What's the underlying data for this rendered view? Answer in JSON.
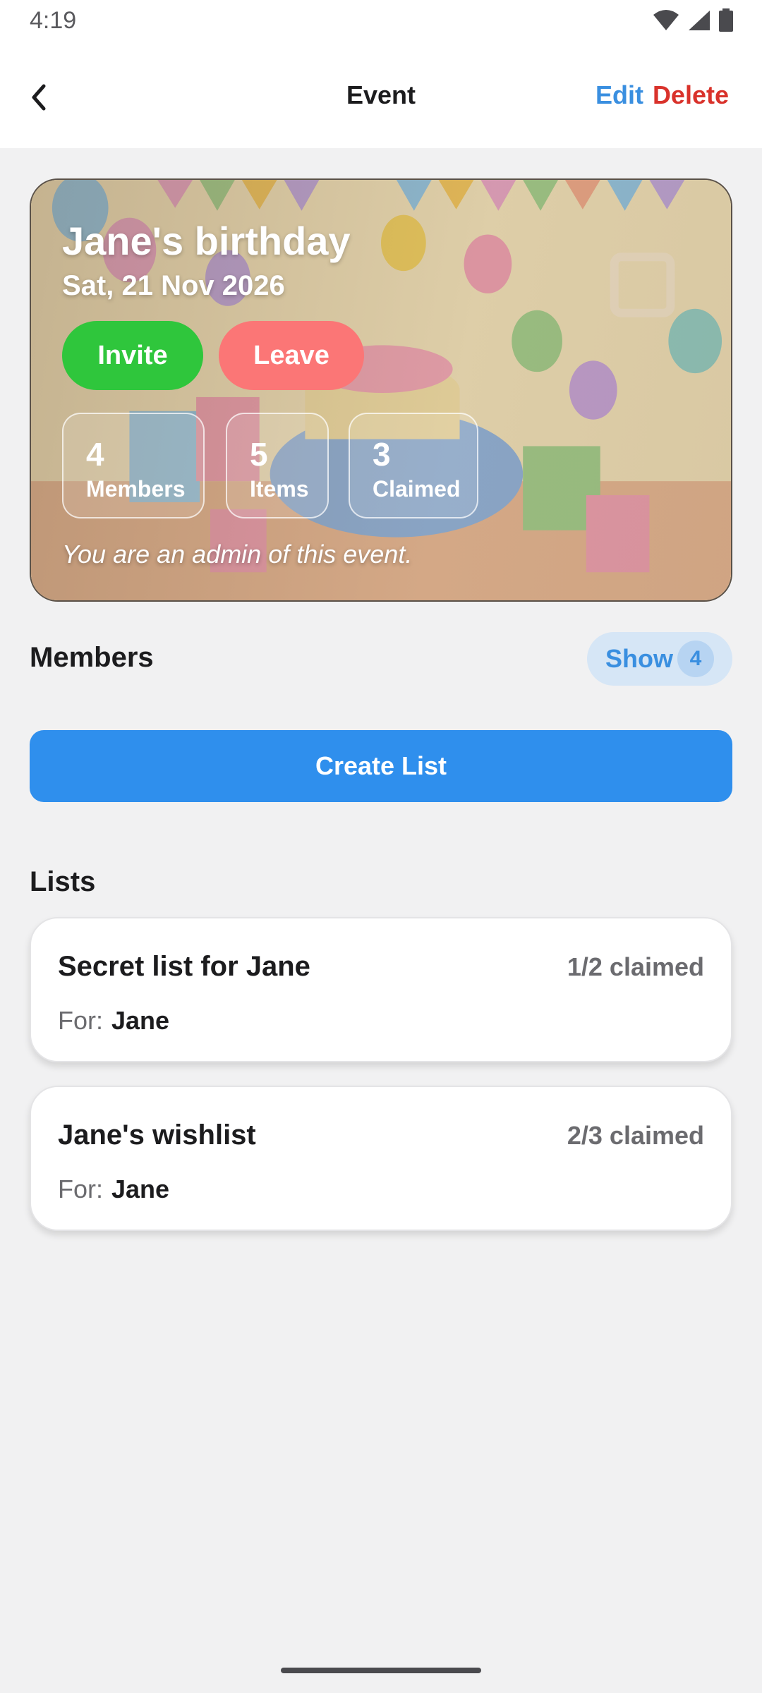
{
  "status_bar": {
    "time": "4:19"
  },
  "header": {
    "title": "Event",
    "edit_label": "Edit",
    "delete_label": "Delete",
    "back_icon": "chevron-left-icon"
  },
  "event": {
    "title": "Jane's birthday",
    "date": "Sat, 21 Nov 2026",
    "invite_label": "Invite",
    "leave_label": "Leave",
    "stats": [
      {
        "value": "4",
        "label": "Members"
      },
      {
        "value": "5",
        "label": "Items"
      },
      {
        "value": "3",
        "label": "Claimed"
      }
    ],
    "admin_note": "You are an admin of this event."
  },
  "members": {
    "heading": "Members",
    "show_label": "Show",
    "count": "4"
  },
  "create_list_label": "Create List",
  "lists": {
    "heading": "Lists",
    "items": [
      {
        "title": "Secret list for Jane",
        "claimed": "1/2 claimed",
        "for_label": "For:",
        "for_name": "Jane"
      },
      {
        "title": "Jane's wishlist",
        "claimed": "2/3 claimed",
        "for_label": "For:",
        "for_name": "Jane"
      }
    ]
  },
  "colors": {
    "accent": "#2f8fed",
    "link": "#3a8fe0",
    "danger": "#d9322b",
    "invite": "#2fc63c",
    "leave": "#fb7676",
    "background": "#f1f1f2"
  }
}
